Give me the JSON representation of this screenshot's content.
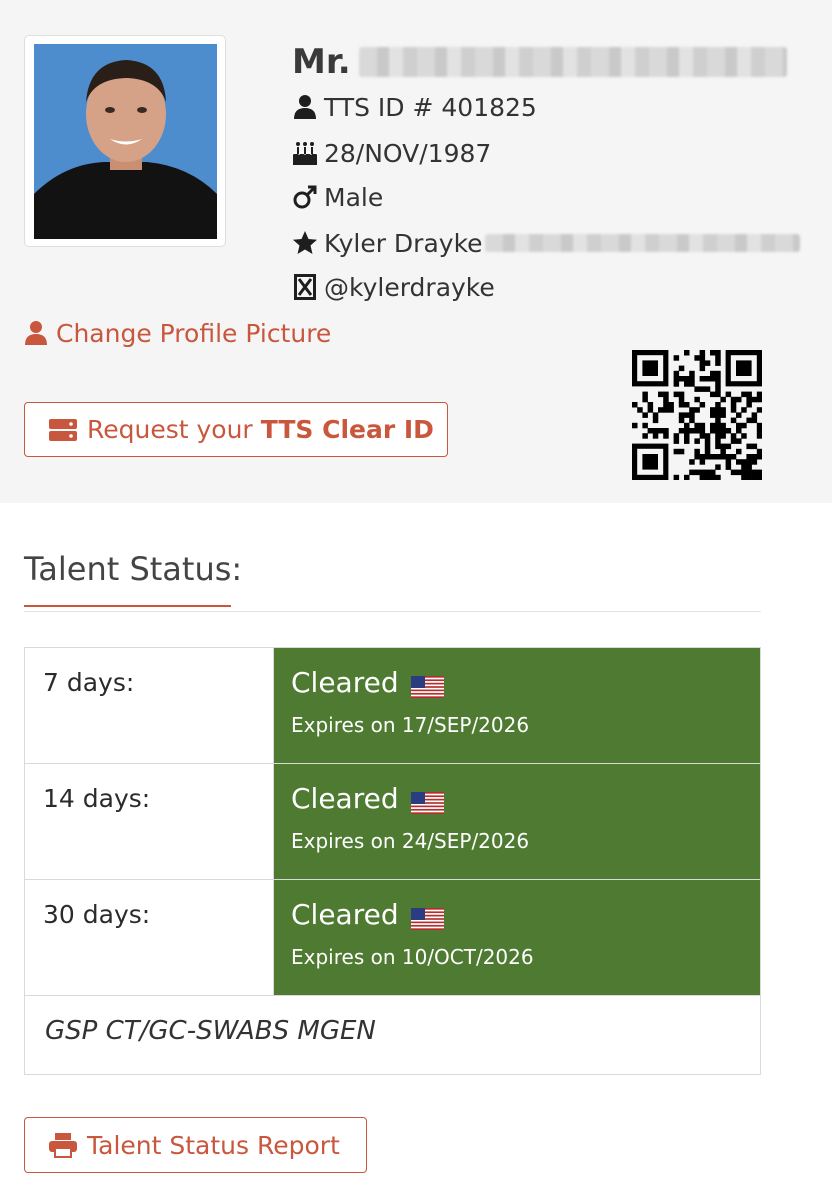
{
  "profile": {
    "name_prefix": "Mr.",
    "tts_id": "TTS ID # 401825",
    "birth_date": "28/NOV/1987",
    "gender": "Male",
    "stage_name": "Kyler Drayke",
    "social_handle": "@kylerdrayke",
    "change_picture_label": "Change Profile Picture",
    "request_label_prefix": "Request your",
    "request_label_bold": "TTS Clear ID",
    "icons": {
      "id": "user-icon",
      "birth": "birthday-cake-icon",
      "gender": "male-symbol-icon",
      "name": "star-icon",
      "social": "x-twitter-icon",
      "change": "user-icon",
      "request": "server-icon",
      "qr": "qr-code-icon"
    }
  },
  "talent_status": {
    "title": "Talent Status:",
    "rows": [
      {
        "label": "7 days:",
        "status": "Cleared",
        "expires": "Expires on 17/SEP/2026"
      },
      {
        "label": "14 days:",
        "status": "Cleared",
        "expires": "Expires on 24/SEP/2026"
      },
      {
        "label": "30 days:",
        "status": "Cleared",
        "expires": "Expires on 10/OCT/2026"
      }
    ],
    "footer": "GSP CT/GC-SWABS MGEN",
    "report_label": "Talent Status Report",
    "report_icon": "printer-icon",
    "flag_icon": "us-flag-icon"
  },
  "colors": {
    "accent": "#c9573d",
    "cleared_bg": "#4e7a31",
    "header_bg": "#f5f5f5"
  }
}
